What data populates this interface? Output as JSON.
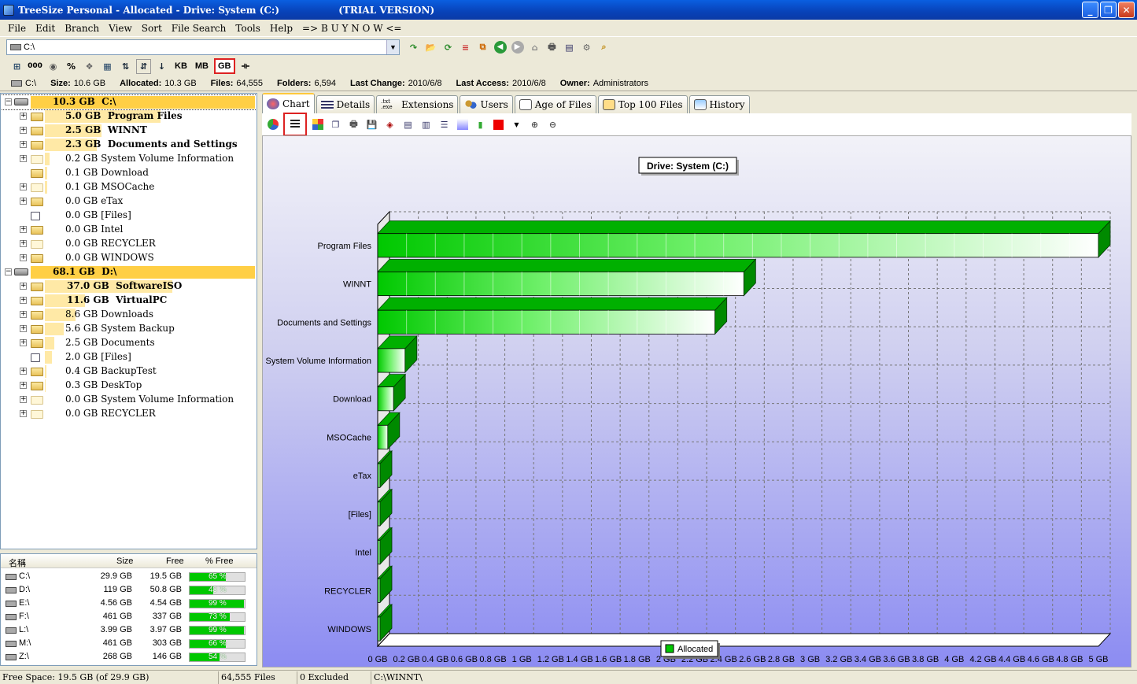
{
  "window": {
    "title": "TreeSize Personal - Allocated - Drive: System (C:)                  (TRIAL VERSION)"
  },
  "menu": [
    "File",
    "Edit",
    "Branch",
    "View",
    "Sort",
    "File Search",
    "Tools",
    "Help",
    "=> B U Y   N O W <="
  ],
  "address": {
    "value": "C:\\"
  },
  "units": {
    "kb": "KB",
    "mb": "MB",
    "gb": "GB",
    "selected": "GB"
  },
  "info": {
    "drive": "C:\\",
    "size_label": "Size:",
    "size": "10.6 GB",
    "alloc_label": "Allocated:",
    "alloc": "10.3 GB",
    "files_label": "Files:",
    "files": "64,555",
    "folders_label": "Folders:",
    "folders": "6,594",
    "lastchange_label": "Last Change:",
    "lastchange": "2010/6/8",
    "lastaccess_label": "Last Access:",
    "lastaccess": "2010/6/8",
    "owner_label": "Owner:",
    "owner": "Administrators"
  },
  "tree": [
    {
      "size": "10.3 GB",
      "name": "C:\\",
      "level": 0,
      "bold": true,
      "kind": "drive",
      "fill": 1.0
    },
    {
      "size": "5.0 GB",
      "name": "Program Files",
      "level": 1,
      "bold": true,
      "kind": "folder",
      "fill": 0.49
    },
    {
      "size": "2.5 GB",
      "name": "WINNT",
      "level": 1,
      "bold": true,
      "kind": "folder",
      "fill": 0.24
    },
    {
      "size": "2.3 GB",
      "name": "Documents and Settings",
      "level": 1,
      "bold": true,
      "kind": "folder",
      "fill": 0.22
    },
    {
      "size": "0.2 GB",
      "name": "System Volume Information",
      "level": 1,
      "bold": false,
      "kind": "folder-light",
      "fill": 0.02
    },
    {
      "size": "0.1 GB",
      "name": "Download",
      "level": 1,
      "bold": false,
      "kind": "folder",
      "fill": 0.01,
      "noexp": true
    },
    {
      "size": "0.1 GB",
      "name": "MSOCache",
      "level": 1,
      "bold": false,
      "kind": "folder-light",
      "fill": 0.01
    },
    {
      "size": "0.0 GB",
      "name": "eTax",
      "level": 1,
      "bold": false,
      "kind": "folder",
      "fill": 0
    },
    {
      "size": "0.0 GB",
      "name": "[Files]",
      "level": 1,
      "bold": false,
      "kind": "file",
      "fill": 0,
      "noexp": true
    },
    {
      "size": "0.0 GB",
      "name": "Intel",
      "level": 1,
      "bold": false,
      "kind": "folder",
      "fill": 0
    },
    {
      "size": "0.0 GB",
      "name": "RECYCLER",
      "level": 1,
      "bold": false,
      "kind": "folder-light",
      "fill": 0
    },
    {
      "size": "0.0 GB",
      "name": "WINDOWS",
      "level": 1,
      "bold": false,
      "kind": "folder",
      "fill": 0
    },
    {
      "size": "68.1 GB",
      "name": "D:\\",
      "level": 0,
      "bold": true,
      "kind": "drive",
      "fill": 1.0
    },
    {
      "size": "37.0 GB",
      "name": "SoftwareISO",
      "level": 1,
      "bold": true,
      "kind": "folder",
      "fill": 0.54
    },
    {
      "size": "11.6 GB",
      "name": "VirtualPC",
      "level": 1,
      "bold": true,
      "kind": "folder",
      "fill": 0.17
    },
    {
      "size": "8.6 GB",
      "name": "Downloads",
      "level": 1,
      "bold": false,
      "kind": "folder",
      "fill": 0.13
    },
    {
      "size": "5.6 GB",
      "name": "System Backup",
      "level": 1,
      "bold": false,
      "kind": "folder",
      "fill": 0.08
    },
    {
      "size": "2.5 GB",
      "name": "Documents",
      "level": 1,
      "bold": false,
      "kind": "folder",
      "fill": 0.04
    },
    {
      "size": "2.0 GB",
      "name": "[Files]",
      "level": 1,
      "bold": false,
      "kind": "file",
      "fill": 0.03,
      "noexp": true
    },
    {
      "size": "0.4 GB",
      "name": "BackupTest",
      "level": 1,
      "bold": false,
      "kind": "folder",
      "fill": 0.006
    },
    {
      "size": "0.3 GB",
      "name": "DeskTop",
      "level": 1,
      "bold": false,
      "kind": "folder",
      "fill": 0.004
    },
    {
      "size": "0.0 GB",
      "name": "System Volume Information",
      "level": 1,
      "bold": false,
      "kind": "folder-light",
      "fill": 0
    },
    {
      "size": "0.0 GB",
      "name": "RECYCLER",
      "level": 1,
      "bold": false,
      "kind": "folder-light",
      "fill": 0
    }
  ],
  "drives_header": {
    "name": "名稱",
    "size": "Size",
    "free": "Free",
    "pct": "% Free"
  },
  "drives": [
    {
      "name": "C:\\",
      "size": "29.9 GB",
      "free": "19.5 GB",
      "pct": "65 %",
      "frac": 0.65
    },
    {
      "name": "D:\\",
      "size": "119 GB",
      "free": "50.8 GB",
      "pct": "43 %",
      "frac": 0.43
    },
    {
      "name": "E:\\",
      "size": "4.56 GB",
      "free": "4.54 GB",
      "pct": "99 %",
      "frac": 0.99
    },
    {
      "name": "F:\\",
      "size": "461 GB",
      "free": "337 GB",
      "pct": "73 %",
      "frac": 0.73
    },
    {
      "name": "L:\\",
      "size": "3.99 GB",
      "free": "3.97 GB",
      "pct": "99 %",
      "frac": 0.99
    },
    {
      "name": "M:\\",
      "size": "461 GB",
      "free": "303 GB",
      "pct": "66 %",
      "frac": 0.66
    },
    {
      "name": "Z:\\",
      "size": "268 GB",
      "free": "146 GB",
      "pct": "54 %",
      "frac": 0.54
    }
  ],
  "tabs": [
    "Chart",
    "Details",
    "Extensions",
    "Users",
    "Age of Files",
    "Top 100 Files",
    "History"
  ],
  "tab_ext_icon": ".txt .exe",
  "active_tab": "Chart",
  "chart_data": {
    "type": "bar",
    "orientation": "horizontal",
    "title": "Drive: System (C:)",
    "categories": [
      "Program Files",
      "WINNT",
      "Documents and Settings",
      "System Volume Information",
      "Download",
      "MSOCache",
      "eTax",
      "[Files]",
      "Intel",
      "RECYCLER",
      "WINDOWS"
    ],
    "series": [
      {
        "name": "Allocated",
        "values": [
          5.0,
          2.54,
          2.34,
          0.19,
          0.11,
          0.07,
          0.01,
          0.0,
          0.0,
          0.0,
          0.0
        ]
      }
    ],
    "xlim": [
      0,
      5
    ],
    "ticks": [
      "0 GB",
      "0.2 GB",
      "0.4 GB",
      "0.6 GB",
      "0.8 GB",
      "1 GB",
      "1.2 GB",
      "1.4 GB",
      "1.6 GB",
      "1.8 GB",
      "2 GB",
      "2.2 GB",
      "2.4 GB",
      "2.6 GB",
      "2.8 GB",
      "3 GB",
      "3.2 GB",
      "3.4 GB",
      "3.6 GB",
      "3.8 GB",
      "4 GB",
      "4.2 GB",
      "4.4 GB",
      "4.6 GB",
      "4.8 GB",
      "5 GB"
    ],
    "grid": true,
    "legend": "bottom",
    "bar_color": "#00c800"
  },
  "status": {
    "free": "Free Space: 19.5 GB  (of 29.9 GB)",
    "files": "64,555  Files",
    "excluded": "0 Excluded",
    "path": "C:\\WINNT\\"
  }
}
